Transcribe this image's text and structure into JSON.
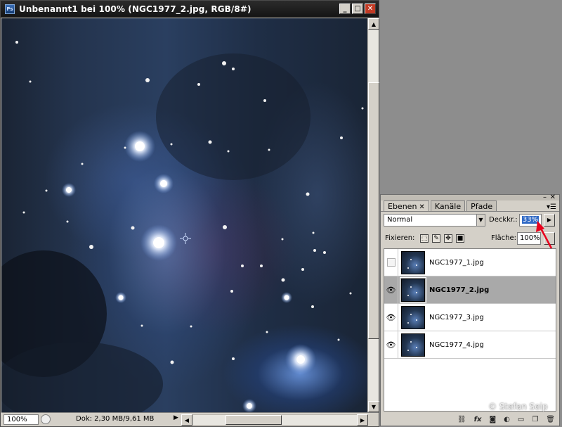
{
  "window": {
    "title": "Unbenannt1 bei 100% (NGC1977_2.jpg, RGB/8#)",
    "app_icon": "Ps",
    "buttons": {
      "minimize": "_",
      "maximize": "□",
      "close": "✕"
    }
  },
  "status": {
    "zoom": "100%",
    "doc_info": "Dok: 2,30 MB/9,61 MB",
    "arrow": "▶"
  },
  "layers_panel": {
    "tabs": [
      {
        "label": "Ebenen",
        "close": "✕"
      },
      {
        "label": "Kanäle"
      },
      {
        "label": "Pfade"
      }
    ],
    "blend_mode": "Normal",
    "opacity_label": "Deckkr.:",
    "opacity_value": "33%",
    "lock_label": "Fixieren:",
    "fill_label": "Fläche:",
    "fill_value": "100%",
    "layers": [
      {
        "name": "NGC1977_1.jpg",
        "visible": false,
        "selected": false
      },
      {
        "name": "NGC1977_2.jpg",
        "visible": true,
        "selected": true
      },
      {
        "name": "NGC1977_3.jpg",
        "visible": true,
        "selected": false
      },
      {
        "name": "NGC1977_4.jpg",
        "visible": true,
        "selected": false
      }
    ],
    "bottom_icons": [
      "link-icon",
      "fx-icon",
      "mask-icon",
      "adjustment-icon",
      "folder-icon",
      "new-layer-icon",
      "trash-icon"
    ],
    "fx_label": "fx"
  },
  "watermark": "© Stefan Seip",
  "colors": {
    "annotation_arrow": "#e8001c",
    "selection_highlight": "#316ac5"
  }
}
